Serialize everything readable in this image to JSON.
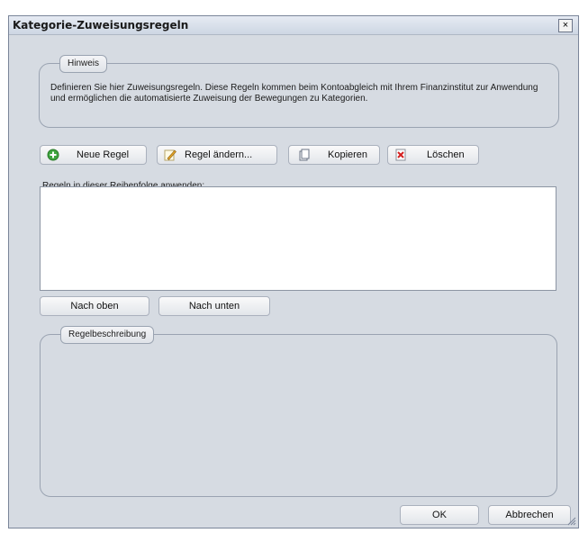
{
  "window": {
    "title": "Kategorie-Zuweisungsregeln",
    "close_glyph": "×"
  },
  "hint": {
    "legend": "Hinweis",
    "text": "Definieren Sie hier Zuweisungsregeln. Diese Regeln kommen beim Kontoabgleich mit Ihrem Finanzinstitut zur Anwendung und ermöglichen die automatisierte Zuweisung der Bewegungen zu Kategorien."
  },
  "toolbar": {
    "new_rule": "Neue Regel",
    "edit_rule": "Regel ändern...",
    "copy": "Kopieren",
    "delete": "Löschen"
  },
  "rules": {
    "label": "Regeln in dieser Reihenfolge anwenden:",
    "items": []
  },
  "order": {
    "up": "Nach oben",
    "down": "Nach unten"
  },
  "description": {
    "legend": "Regelbeschreibung"
  },
  "footer": {
    "ok": "OK",
    "cancel": "Abbrechen"
  },
  "icons": {
    "new_rule": "plus-icon",
    "edit_rule": "pencil-icon",
    "copy": "copy-icon",
    "delete": "delete-icon"
  },
  "colors": {
    "dialog_bg": "#d6dbe2",
    "border": "#9aa3b1"
  }
}
